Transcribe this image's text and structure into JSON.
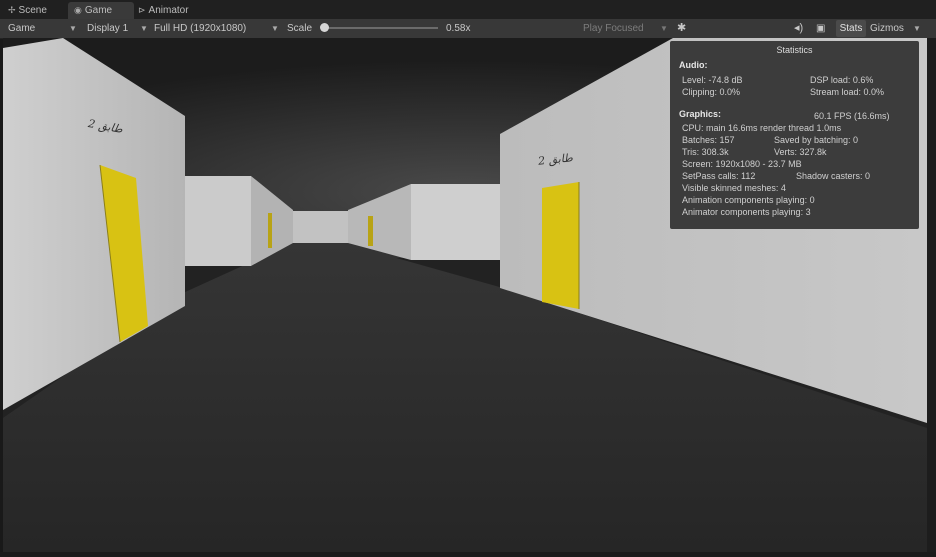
{
  "tabs": [
    {
      "icon": "scene-icon",
      "glyph": "✢",
      "label": "Scene"
    },
    {
      "icon": "game-icon",
      "glyph": "◉",
      "label": "Game"
    },
    {
      "icon": "animator-icon",
      "glyph": "⊳",
      "label": "Animator"
    }
  ],
  "toolbar": {
    "view_mode": "Game",
    "display": "Display 1",
    "resolution": "Full HD (1920x1080)",
    "scale_label": "Scale",
    "scale_value": "0.58x",
    "play_mode": "Play Focused",
    "stats_label": "Stats",
    "gizmos_label": "Gizmos"
  },
  "stats": {
    "title": "Statistics",
    "audio_header": "Audio:",
    "level": "Level: -74.8 dB",
    "dsp_load": "DSP load: 0.6%",
    "clipping": "Clipping: 0.0%",
    "stream_load": "Stream load: 0.0%",
    "graphics_header": "Graphics:",
    "fps": "60.1 FPS (16.6ms)",
    "cpu": "CPU: main 16.6ms render thread 1.0ms",
    "batches": "Batches: 157",
    "saved_batching": "Saved by batching: 0",
    "tris": "Tris: 308.3k",
    "verts": "Verts: 327.8k",
    "screen": "Screen: 1920x1080 - 23.7 MB",
    "setpass": "SetPass calls: 112",
    "shadow_casters": "Shadow casters: 0",
    "skinned": "Visible skinned meshes: 4",
    "animation": "Animation components playing: 0",
    "animator": "Animator components playing: 3"
  },
  "signs": {
    "left": "2 طابق",
    "right": "2 طابق"
  },
  "colors": {
    "door": "#d8c213",
    "wall": "#c9c9c9",
    "floor": "#2a2a2a"
  }
}
